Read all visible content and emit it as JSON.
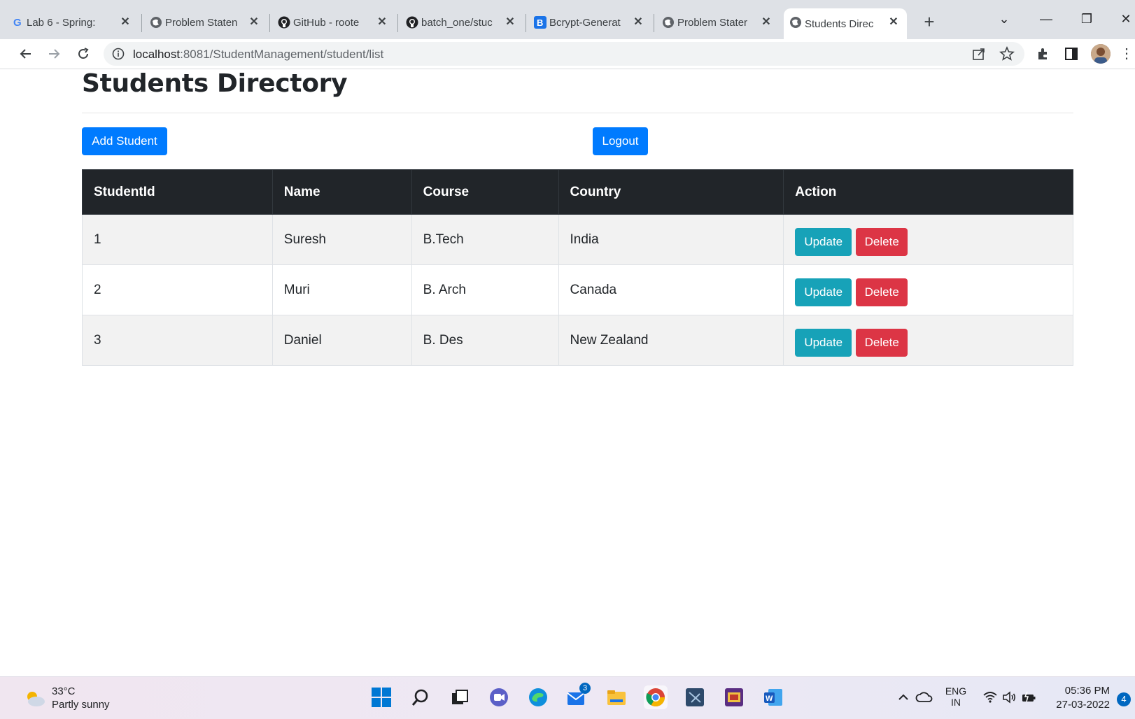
{
  "browser": {
    "tabs": [
      {
        "title": "Lab 6 - Spring:",
        "icon": "google-icon"
      },
      {
        "title": "Problem Staten",
        "icon": "globe-icon"
      },
      {
        "title": "GitHub - roote",
        "icon": "github-icon"
      },
      {
        "title": "batch_one/stuc",
        "icon": "github-icon"
      },
      {
        "title": "Bcrypt-Generat",
        "icon": "bootstrap-icon"
      },
      {
        "title": "Problem Stater",
        "icon": "globe-icon"
      },
      {
        "title": "Students Direc",
        "icon": "globe-icon"
      }
    ],
    "url_host": "localhost",
    "url_rest": ":8081/StudentManagement/student/list"
  },
  "page": {
    "title": "Students Directory",
    "add_button": "Add Student",
    "logout_button": "Logout"
  },
  "table": {
    "headers": [
      "StudentId",
      "Name",
      "Course",
      "Country",
      "Action"
    ],
    "rows": [
      {
        "id": "1",
        "name": "Suresh",
        "course": "B.Tech",
        "country": "India"
      },
      {
        "id": "2",
        "name": "Muri",
        "course": "B. Arch",
        "country": "Canada"
      },
      {
        "id": "3",
        "name": "Daniel",
        "course": "B. Des",
        "country": "New Zealand"
      }
    ],
    "update_label": "Update",
    "delete_label": "Delete"
  },
  "taskbar": {
    "temperature": "33°C",
    "weather": "Partly sunny",
    "mail_badge": "3",
    "lang": "ENG",
    "region": "IN",
    "time": "05:36 PM",
    "date": "27-03-2022",
    "notifications": "4"
  },
  "colors": {
    "primary": "#007bff",
    "info": "#17a2b8",
    "danger": "#dc3545",
    "table_header": "#212529"
  }
}
